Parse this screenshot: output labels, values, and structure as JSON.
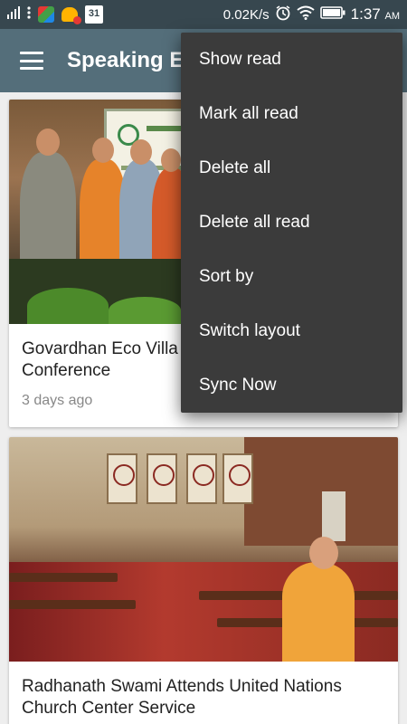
{
  "status_bar": {
    "calendar_day": "31",
    "network_speed": "0.02K/s",
    "time": "1:37",
    "ampm": "AM",
    "icons": [
      "signal-icon",
      "more-dots-icon",
      "app-notification-icon",
      "alert-app-icon",
      "calendar-icon",
      "alarm-icon",
      "wifi-icon",
      "battery-icon"
    ]
  },
  "app_bar": {
    "title": "Speaking Ev",
    "menu_icon": "hamburger-menu-icon"
  },
  "cards": [
    {
      "title": "Govardhan Eco Villa Conference",
      "title_line1": "Govardhan Eco Villa",
      "title_line2": "Conference",
      "meta": "3 days ago"
    },
    {
      "title": "Radhanath Swami Attends United Nations Church Center Service",
      "title_line1": "Radhanath Swami Attends United Nations",
      "title_line2": "Church Center Service"
    }
  ],
  "overflow_menu": {
    "items": [
      "Show read",
      "Mark all read",
      "Delete all",
      "Delete all read",
      "Sort by",
      "Switch layout",
      "Sync Now"
    ]
  }
}
